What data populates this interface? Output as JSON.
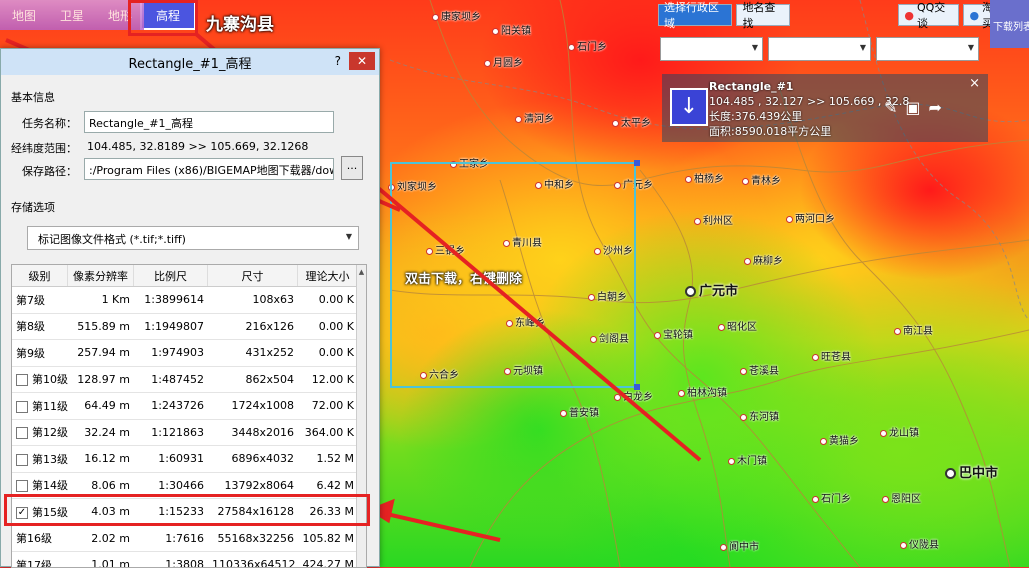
{
  "map_types": {
    "map": "地图",
    "satellite": "卫星",
    "terrain": "地形",
    "elevation": "高程"
  },
  "corner_title": "九寨沟县",
  "toolbar": {
    "select_region": "选择行政区域",
    "place_search": "地名查找",
    "qq": "QQ交谈",
    "taobao": "淘宝购买",
    "download_list": "下载列表"
  },
  "info_popup": {
    "title": "Rectangle_#1",
    "coords": "104.485 , 32.127 >> 105.669 , 32.8",
    "perimeter": "长度:376.439公里",
    "area": "面积:8590.018平方公里",
    "close": "×"
  },
  "map_hint": "双击下载，右键删除",
  "places": [
    {
      "name": "康家坝乡"
    },
    {
      "name": "阳关镇"
    },
    {
      "name": "石门乡"
    },
    {
      "name": "月圆乡"
    },
    {
      "name": "清河乡"
    },
    {
      "name": "太平乡"
    },
    {
      "name": "王家乡"
    },
    {
      "name": "刘家坝乡"
    },
    {
      "name": "中和乡"
    },
    {
      "name": "广元乡"
    },
    {
      "name": "柏杨乡"
    },
    {
      "name": "青林乡"
    },
    {
      "name": "三锅乡"
    },
    {
      "name": "青川县"
    },
    {
      "name": "沙州乡"
    },
    {
      "name": "利州区"
    },
    {
      "name": "两河口乡"
    },
    {
      "name": "麻柳乡"
    },
    {
      "name": "东峰乡"
    },
    {
      "name": "白朝乡"
    },
    {
      "name": "宝轮镇"
    },
    {
      "name": "剑阁县"
    },
    {
      "name": "昭化区"
    },
    {
      "name": "元坝镇"
    },
    {
      "name": "六合乡"
    },
    {
      "name": "白龙乡"
    },
    {
      "name": "普安镇"
    },
    {
      "name": "柏林沟镇"
    },
    {
      "name": "苍溪县"
    },
    {
      "name": "旺苍县"
    },
    {
      "name": "南江县"
    },
    {
      "name": "木门镇"
    },
    {
      "name": "东河镇"
    },
    {
      "name": "黄猫乡"
    },
    {
      "name": "龙山镇"
    },
    {
      "name": "石门乡"
    },
    {
      "name": "巴中市"
    },
    {
      "name": "恩阳区"
    },
    {
      "name": "仪陇县"
    },
    {
      "name": "阆中市"
    }
  ],
  "city": "广元市",
  "dialog": {
    "title": "Rectangle_#1_高程",
    "help": "?",
    "close": "✕",
    "basic_info": "基本信息",
    "task_name_label": "任务名称：",
    "task_name": "Rectangle_#1_高程",
    "range_label": "经纬度范围：",
    "range_value": "104.485, 32.8189   >>   105.669, 32.1268",
    "save_label": "保存路径：",
    "save_path": ":/Program Files (x86)/BIGEMAP地图下载器/download",
    "browse": "...",
    "storage_options": "存储选项",
    "format": "标记图像文件格式 (*.tif;*.tiff)",
    "columns": [
      "级别",
      "像素分辨率",
      "比例尺",
      "尺寸",
      "理论大小"
    ],
    "rows": [
      {
        "level": "第7级",
        "res": "1 Km",
        "scale": "1:3899614",
        "size": "108x63",
        "bytes": "0.00 K",
        "checkbox": false,
        "checked": false
      },
      {
        "level": "第8级",
        "res": "515.89  m",
        "scale": "1:1949807",
        "size": "216x126",
        "bytes": "0.00 K",
        "checkbox": false,
        "checked": false
      },
      {
        "level": "第9级",
        "res": "257.94  m",
        "scale": "1:974903",
        "size": "431x252",
        "bytes": "0.00 K",
        "checkbox": false,
        "checked": false
      },
      {
        "level": "第10级",
        "res": "128.97  m",
        "scale": "1:487452",
        "size": "862x504",
        "bytes": "12.00 K",
        "checkbox": true,
        "checked": false
      },
      {
        "level": "第11级",
        "res": "64.49  m",
        "scale": "1:243726",
        "size": "1724x1008",
        "bytes": "72.00 K",
        "checkbox": true,
        "checked": false
      },
      {
        "level": "第12级",
        "res": "32.24  m",
        "scale": "1:121863",
        "size": "3448x2016",
        "bytes": "364.00 K",
        "checkbox": true,
        "checked": false
      },
      {
        "level": "第13级",
        "res": "16.12  m",
        "scale": "1:60931",
        "size": "6896x4032",
        "bytes": "1.52 M",
        "checkbox": true,
        "checked": false
      },
      {
        "level": "第14级",
        "res": "8.06  m",
        "scale": "1:30466",
        "size": "13792x8064",
        "bytes": "6.42 M",
        "checkbox": true,
        "checked": false
      },
      {
        "level": "第15级",
        "res": "4.03  m",
        "scale": "1:15233",
        "size": "27584x16128",
        "bytes": "26.33 M",
        "checkbox": true,
        "checked": true
      },
      {
        "level": "第16级",
        "res": "2.02  m",
        "scale": "1:7616",
        "size": "55168x32256",
        "bytes": "105.82 M",
        "checkbox": false,
        "checked": false
      },
      {
        "level": "第17级",
        "res": "1.01  m",
        "scale": "1:3808",
        "size": "110336x64512",
        "bytes": "424.27 M",
        "checkbox": false,
        "checked": false
      }
    ]
  },
  "colors": {
    "highlight": "#e52222",
    "selection": "#4cc3d8",
    "active_tab": "#4b55e0"
  }
}
